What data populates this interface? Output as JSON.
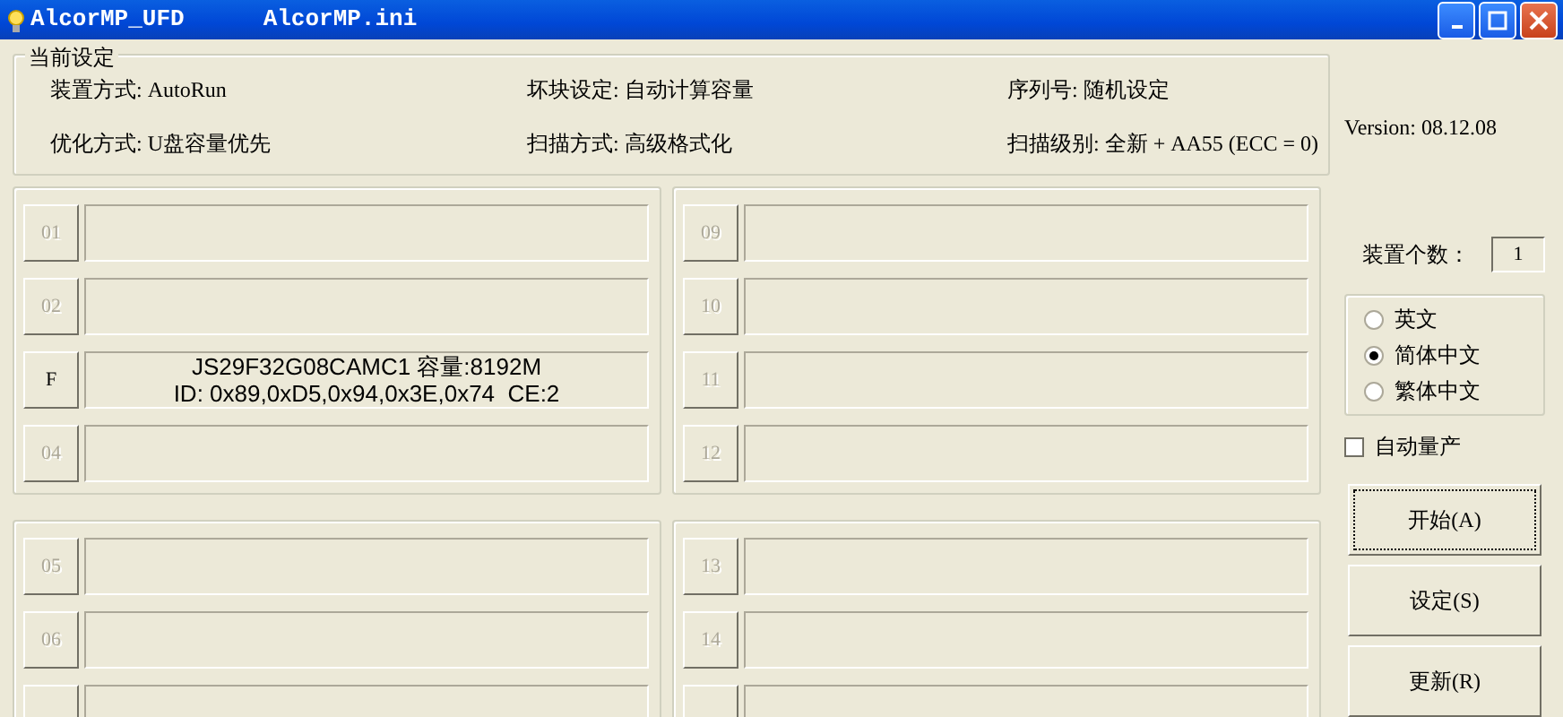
{
  "window": {
    "title": "AlcorMP_UFD",
    "subtitle": "AlcorMP.ini",
    "controls": [
      {
        "kind": "minimize"
      },
      {
        "kind": "maximize"
      },
      {
        "kind": "close"
      }
    ]
  },
  "settings": {
    "title": "当前设定",
    "items": [
      {
        "text": "装置方式: AutoRun"
      },
      {
        "text": "坏块设定: 自动计算容量"
      },
      {
        "text": "序列号: 随机设定"
      },
      {
        "text": "优化方式: U盘容量优先"
      },
      {
        "text": "扫描方式: 高级格式化"
      },
      {
        "text": "扫描级别: 全新 + AA55 (ECC = 0)"
      }
    ]
  },
  "version": "Version: 08.12.08",
  "port_groups": [
    {
      "ports": [
        {
          "label": "01",
          "enabled": false
        },
        {
          "label": "02",
          "enabled": false
        },
        {
          "label": "F",
          "enabled": true,
          "info": [
            "JS29F32G08CAMC1 容量:8192M",
            "ID: 0x89,0xD5,0x94,0x3E,0x74  CE:2"
          ]
        },
        {
          "label": "04",
          "enabled": false
        }
      ]
    },
    {
      "ports": [
        {
          "label": "09",
          "enabled": false
        },
        {
          "label": "10",
          "enabled": false
        },
        {
          "label": "11",
          "enabled": false
        },
        {
          "label": "12",
          "enabled": false
        }
      ]
    },
    {
      "ports": [
        {
          "label": "05",
          "enabled": false
        },
        {
          "label": "06",
          "enabled": false
        }
      ],
      "clipped": true
    },
    {
      "ports": [
        {
          "label": "13",
          "enabled": false
        },
        {
          "label": "14",
          "enabled": false
        }
      ],
      "clipped": true
    }
  ],
  "device_count": {
    "label": "装置个数：",
    "value": "1"
  },
  "languages": [
    {
      "label": "英文",
      "selected": false
    },
    {
      "label": "简体中文",
      "selected": true
    },
    {
      "label": "繁体中文",
      "selected": false
    }
  ],
  "auto_production": {
    "label": "自动量产",
    "checked": false
  },
  "buttons": [
    {
      "label": "开始(A)",
      "focused": true
    },
    {
      "label": "设定(S)",
      "focused": false
    },
    {
      "label": "更新(R)",
      "focused": false
    }
  ]
}
